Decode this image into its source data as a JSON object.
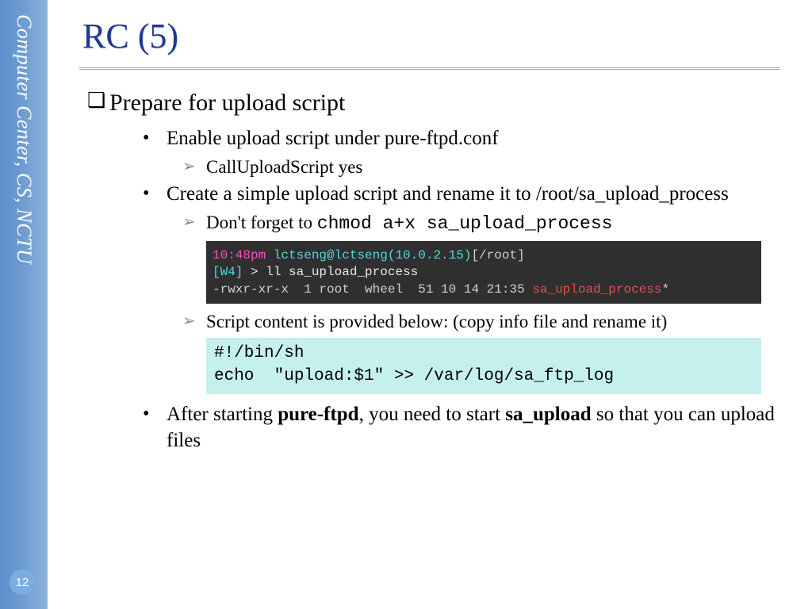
{
  "sidebar": {
    "label": "Computer Center, CS, NCTU"
  },
  "title": "RC (5)",
  "page_number": "12",
  "bullets": {
    "l1_prepare": "Prepare for upload script",
    "l2_enable": "Enable upload script under pure-ftpd.conf",
    "l3_callupload": "CallUploadScript yes",
    "l2_create": "Create a simple upload script and rename it to /root/sa_upload_process",
    "l3_chmod_pre": "Don't forget to ",
    "l3_chmod_code": "chmod a+x sa_upload_process",
    "l3_script_below": "Script content is provided below: (copy info file and rename it)",
    "l2_after_1": "After starting ",
    "l2_after_b1": "pure-ftpd",
    "l2_after_2": ", you need to start ",
    "l2_after_b2": "sa_upload",
    "l2_after_3": " so that you can upload files"
  },
  "terminal": {
    "time": "10:48pm ",
    "userhost": "lctseng@lctseng(10.0.2.15)",
    "cwd": "[/root]",
    "prompt_l": "[W4]",
    "prompt_r": " > ",
    "cmd": "ll sa_upload_process",
    "perm": "-rwxr-xr-x  1 root  wheel  51 10 14 21:35 ",
    "file": "sa_upload_process",
    "star": "*"
  },
  "script": "#!/bin/sh\necho  \"upload:$1\" >> /var/log/sa_ftp_log",
  "chart_data": null
}
